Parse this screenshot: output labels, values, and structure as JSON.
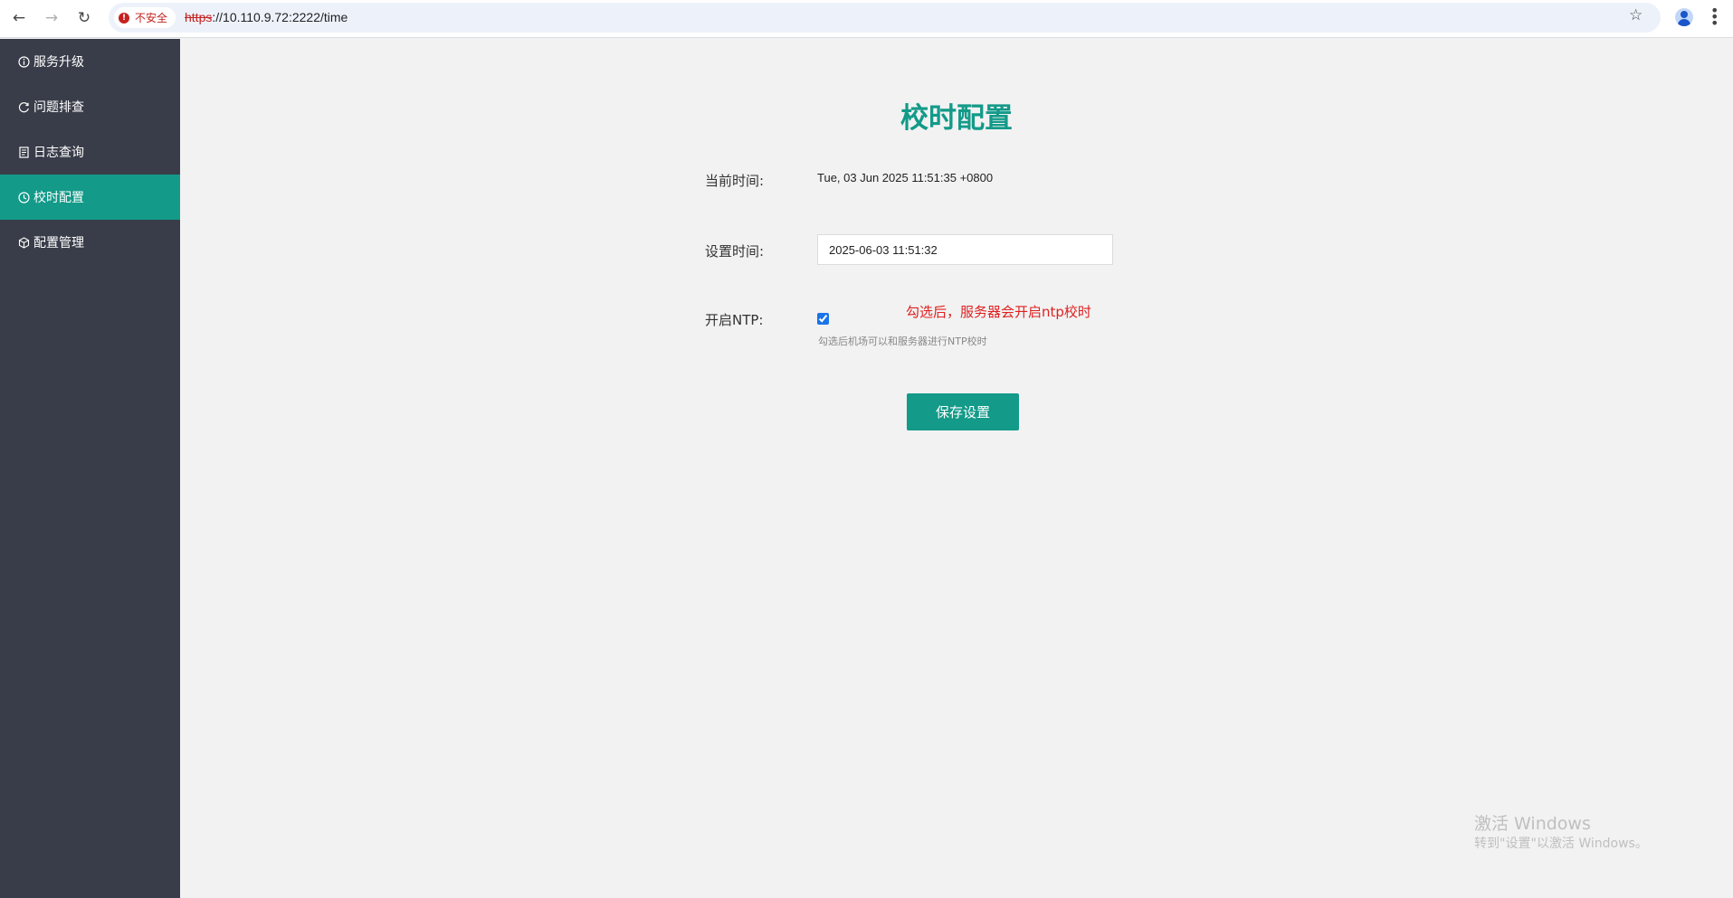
{
  "browser": {
    "security_label": "不安全",
    "url_scheme": "https",
    "url_rest": "://10.110.9.72:2222/time"
  },
  "sidebar": {
    "items": [
      {
        "label": "服务升级",
        "icon": "info-circle-icon"
      },
      {
        "label": "问题排查",
        "icon": "refresh-icon"
      },
      {
        "label": "日志查询",
        "icon": "document-icon"
      },
      {
        "label": "校时配置",
        "icon": "clock-icon",
        "active": true
      },
      {
        "label": "配置管理",
        "icon": "cube-icon"
      }
    ]
  },
  "main": {
    "title": "校时配置",
    "current_time_label": "当前时间:",
    "current_time_value": "Tue, 03 Jun 2025 11:51:35 +0800",
    "set_time_label": "设置时间:",
    "set_time_value": "2025-06-03 11:51:32",
    "ntp_label": "开启NTP:",
    "ntp_checked": true,
    "ntp_note": "勾选后，服务器会开启ntp校时",
    "ntp_help": "勾选后机场可以和服务器进行NTP校时",
    "save_button": "保存设置"
  },
  "watermark": {
    "title": "激活 Windows",
    "subtitle": "转到\"设置\"以激活 Windows。"
  },
  "colors": {
    "accent": "#139a89",
    "sidebar_bg": "#393d49",
    "warning_text": "#e02020"
  }
}
